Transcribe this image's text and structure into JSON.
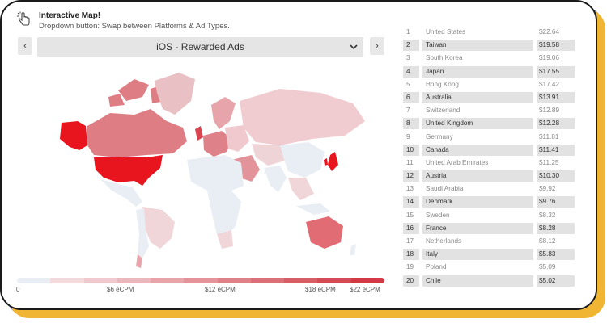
{
  "header": {
    "title": "Interactive Map!",
    "subtitle": "Dropdown button: Swap between Platforms & Ad Types."
  },
  "controls": {
    "prev_label": "‹",
    "next_label": "›",
    "dropdown_value": "iOS - Rewarded Ads"
  },
  "legend": {
    "ticks": [
      "0",
      "$6 eCPM",
      "$12 eCPM",
      "$18 eCPM",
      "$22 eCPM"
    ],
    "colors": [
      "#e8eef4",
      "#f3dadd",
      "#efc9cd",
      "#ebb7bc",
      "#e7a5ab",
      "#e3939a",
      "#df8189",
      "#db6f78",
      "#d85d67",
      "#d44b56",
      "#d13945"
    ]
  },
  "ranking": [
    {
      "rank": "1",
      "country": "United States",
      "value": "$22.64"
    },
    {
      "rank": "2",
      "country": "Taiwan",
      "value": "$19.58"
    },
    {
      "rank": "3",
      "country": "South Korea",
      "value": "$19.06"
    },
    {
      "rank": "4",
      "country": "Japan",
      "value": "$17.55"
    },
    {
      "rank": "5",
      "country": "Hong Kong",
      "value": "$17.42"
    },
    {
      "rank": "6",
      "country": "Australia",
      "value": "$13.91"
    },
    {
      "rank": "7",
      "country": "Switzerland",
      "value": "$12.89"
    },
    {
      "rank": "8",
      "country": "United Kingdom",
      "value": "$12.28"
    },
    {
      "rank": "9",
      "country": "Germany",
      "value": "$11.81"
    },
    {
      "rank": "10",
      "country": "Canada",
      "value": "$11.41"
    },
    {
      "rank": "11",
      "country": "United Arab Emirates",
      "value": "$11.25"
    },
    {
      "rank": "12",
      "country": "Austria",
      "value": "$10.30"
    },
    {
      "rank": "13",
      "country": "Saudi Arabia",
      "value": "$9.92"
    },
    {
      "rank": "14",
      "country": "Denmark",
      "value": "$9.76"
    },
    {
      "rank": "15",
      "country": "Sweden",
      "value": "$8.32"
    },
    {
      "rank": "16",
      "country": "France",
      "value": "$8.28"
    },
    {
      "rank": "17",
      "country": "Netherlands",
      "value": "$8.12"
    },
    {
      "rank": "18",
      "country": "Italy",
      "value": "$5.83"
    },
    {
      "rank": "19",
      "country": "Poland",
      "value": "$5.09"
    },
    {
      "rank": "20",
      "country": "Chile",
      "value": "$5.02"
    }
  ],
  "colors": {
    "accent_yellow": "#f0b532",
    "accent_blue": "#2b55d4",
    "max_red": "#e8141e"
  }
}
